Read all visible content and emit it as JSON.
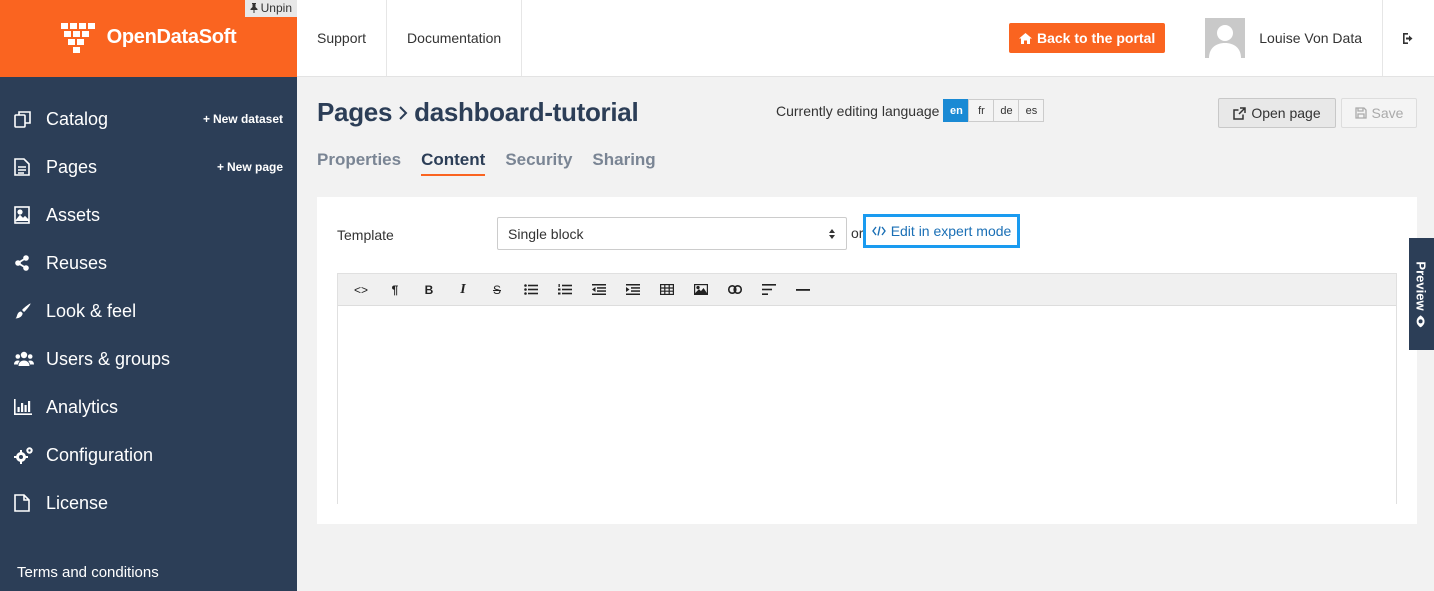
{
  "brand": {
    "name": "OpenDataSoft",
    "unpin_label": "Unpin",
    "colors": {
      "brand": "#fa6420",
      "sidebar": "#2c3e57",
      "link": "#1a6fb5",
      "focus": "#1a9bf0"
    }
  },
  "sidebar": {
    "items": [
      {
        "label": "Catalog",
        "icon": "catalog-icon",
        "action": "New dataset"
      },
      {
        "label": "Pages",
        "icon": "page-icon",
        "action": "New page"
      },
      {
        "label": "Assets",
        "icon": "image-icon"
      },
      {
        "label": "Reuses",
        "icon": "share-icon"
      },
      {
        "label": "Look & feel",
        "icon": "brush-icon"
      },
      {
        "label": "Users & groups",
        "icon": "users-icon"
      },
      {
        "label": "Analytics",
        "icon": "bar-chart-icon"
      },
      {
        "label": "Configuration",
        "icon": "gears-icon"
      },
      {
        "label": "License",
        "icon": "file-icon"
      }
    ],
    "footer_link": "Terms and conditions"
  },
  "topbar": {
    "links": [
      "Support",
      "Documentation"
    ],
    "portal_button": "Back to the portal",
    "user_name": "Louise Von Data"
  },
  "page": {
    "title_section": "Pages",
    "title_page": "dashboard-tutorial",
    "language_label": "Currently editing language",
    "languages": [
      "en",
      "fr",
      "de",
      "es"
    ],
    "active_language": "en",
    "open_button": "Open page",
    "save_button": "Save",
    "tabs": [
      "Properties",
      "Content",
      "Security",
      "Sharing"
    ],
    "active_tab": "Content"
  },
  "content": {
    "template_label": "Template",
    "template_value": "Single block",
    "or_text": "or",
    "expert_mode": "Edit in expert mode",
    "toolbar": [
      "<>",
      "¶",
      "B",
      "I",
      "S",
      "bulleted-list",
      "numbered-list",
      "outdent",
      "indent",
      "table",
      "image",
      "link",
      "align-left",
      "horizontal-rule"
    ]
  },
  "preview_label": "Preview"
}
